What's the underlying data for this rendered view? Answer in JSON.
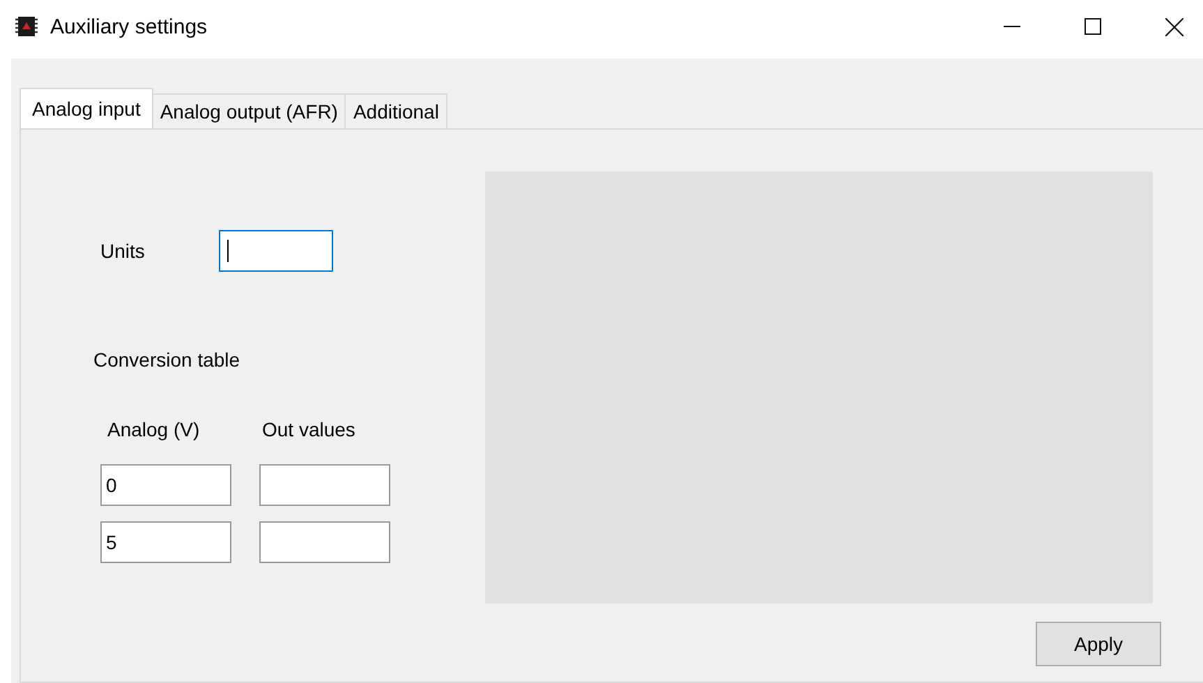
{
  "window": {
    "title": "Auxiliary settings"
  },
  "tabs": [
    {
      "label": "Analog input",
      "selected": true
    },
    {
      "label": "Analog output (AFR)",
      "selected": false
    },
    {
      "label": "Additional",
      "selected": false
    }
  ],
  "units": {
    "label": "Units",
    "focused": true
  },
  "conversion_table": {
    "title": "Conversion table",
    "columns": [
      "Analog (V)",
      "Out values"
    ],
    "rows": [
      {
        "analog": "0"
      },
      {
        "analog": "5"
      }
    ]
  },
  "buttons": [
    "Apply"
  ]
}
